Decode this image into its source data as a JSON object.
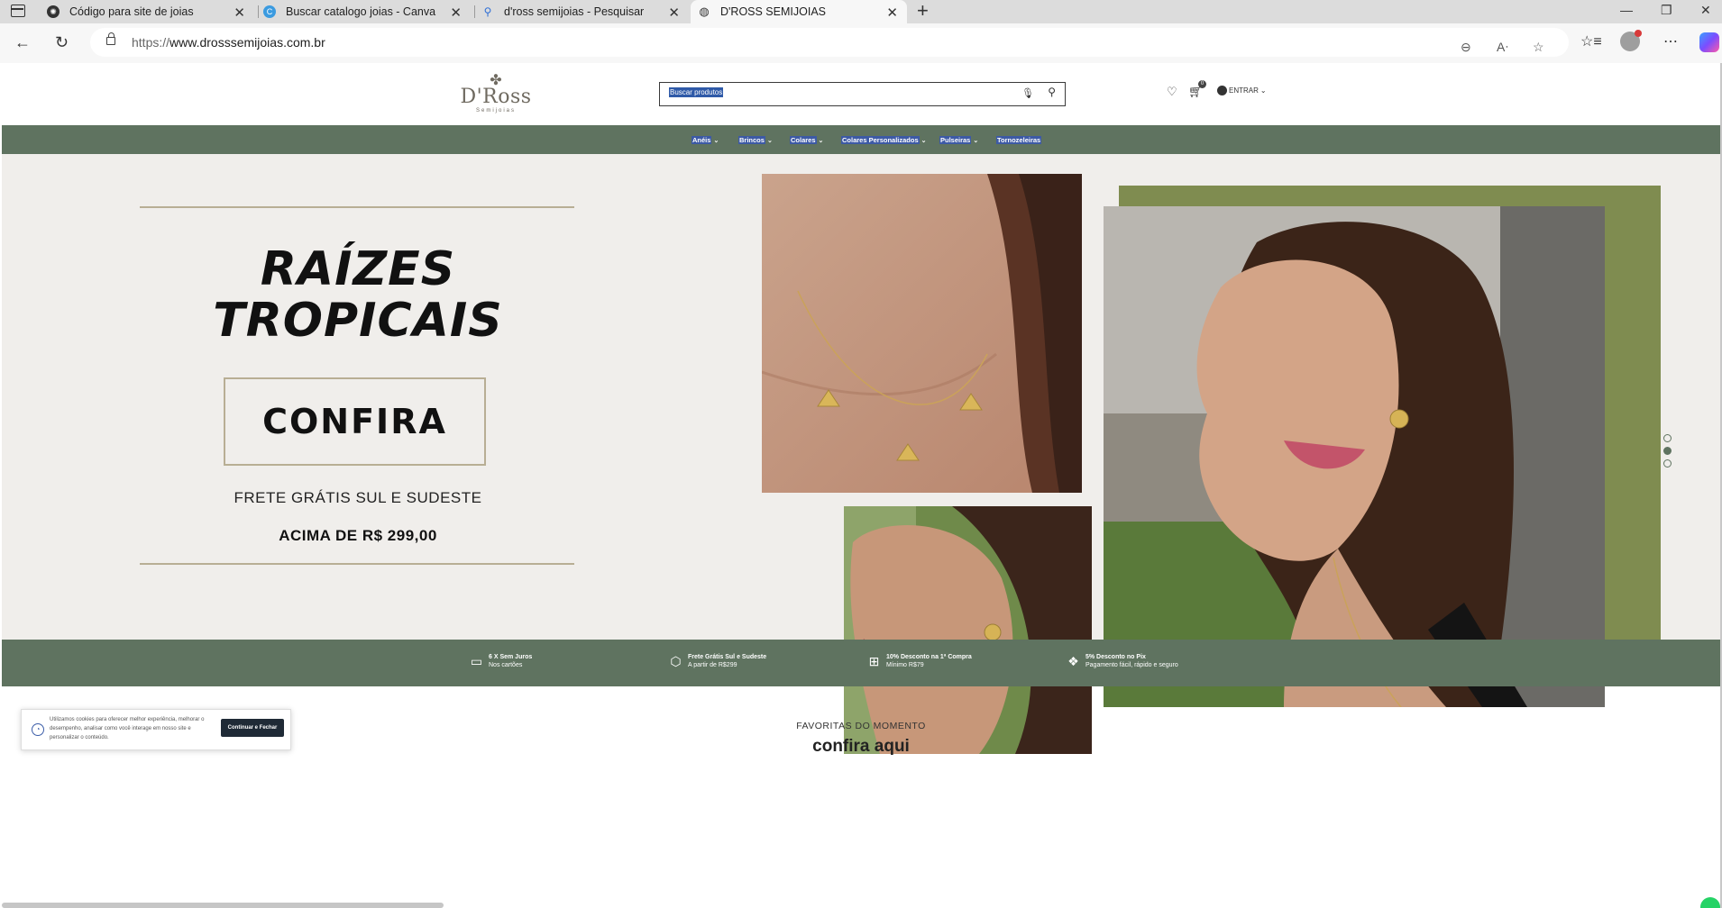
{
  "browser": {
    "tabs": [
      {
        "title": "Código para site de joias",
        "icon": "chatgpt-icon"
      },
      {
        "title": "Buscar catalogo joias - Canva",
        "icon": "canva-icon"
      },
      {
        "title": "d'ross semijoias - Pesquisar",
        "icon": "search-icon"
      },
      {
        "title": "D'ROSS SEMIJOIAS",
        "icon": "globe-icon",
        "active": true
      }
    ],
    "url_prefix": "https://",
    "url_domain": "www.drosssemijoias.com.br"
  },
  "site": {
    "logo_name": "D'Ross",
    "logo_sub": "Semijoias",
    "search_placeholder": "Buscar produtos",
    "cart_count": "0",
    "account_label": "ENTRAR",
    "nav": [
      {
        "label": "Anéis"
      },
      {
        "label": "Brincos"
      },
      {
        "label": "Colares"
      },
      {
        "label": "Colares Personalizados"
      },
      {
        "label": "Pulseiras"
      },
      {
        "label": "Tornozeleiras"
      }
    ],
    "hero": {
      "title_line1": "RAÍZES",
      "title_line2": "TROPICAIS",
      "cta": "CONFIRA",
      "shipping": "FRETE GRÁTIS SUL E SUDESTE",
      "threshold": "ACIMA DE R$ 299,00",
      "accent_color": "#7f8c50"
    },
    "benefits": [
      {
        "title": "6 X Sem Juros",
        "sub": "Nos cartões",
        "icon": "card-icon"
      },
      {
        "title": "Frete Grátis Sul e Sudeste",
        "sub": "A partir de R$299",
        "icon": "box-icon"
      },
      {
        "title": "10% Desconto na 1ª Compra",
        "sub": "Mínimo R$79",
        "icon": "gift-icon"
      },
      {
        "title": "5% Desconto no Pix",
        "sub": "Pagamento fácil, rápido e seguro",
        "icon": "pix-icon"
      }
    ],
    "favorites_label": "FAVORITAS DO MOMENTO",
    "favorites_title": "confira aqui",
    "cookie": {
      "text": "Utilizamos cookies para oferecer melhor experiência, melhorar o desempenho, analisar como você interage em nosso site e personalizar o conteúdo.",
      "button": "Continuar e Fechar"
    },
    "brand_green": "#5f7360"
  }
}
